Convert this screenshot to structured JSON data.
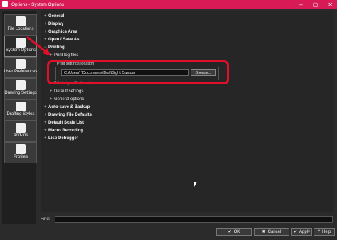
{
  "window": {
    "title": "Options - System Options",
    "controls": [
      "–",
      "▢",
      "✕"
    ]
  },
  "sidebar": {
    "items": [
      {
        "label": "File Locations",
        "icon": "folder-icon",
        "active": false
      },
      {
        "label": "System Options",
        "icon": "list-icon",
        "active": true
      },
      {
        "label": "User Preferences",
        "icon": "user-gear-icon",
        "active": false
      },
      {
        "label": "Drawing Settings",
        "icon": "drawing-icon",
        "active": false
      },
      {
        "label": "Drafting Styles",
        "icon": "style-icon",
        "active": false
      },
      {
        "label": "Add-Ins",
        "icon": "puzzle-icon",
        "active": false
      },
      {
        "label": "Profiles",
        "icon": "profiles-icon",
        "active": false
      }
    ]
  },
  "tree": {
    "general": "General",
    "display": "Display",
    "graphics_area": "Graphics Area",
    "open_save_as": "Open / Save As",
    "printing": "Printing",
    "print_log_files": "Print log files",
    "print_settings_location": "Print settings location",
    "path_value": "C:\\Users\\            \\Documents\\DraftSight Custom",
    "browse_label": "Browse...",
    "print_style_file_location": "Print style file location",
    "default_settings": "Default settings",
    "general_options": "General options",
    "auto_save_backup": "Auto-save & Backup",
    "drawing_file_defaults": "Drawing File Defaults",
    "default_scale_list": "Default Scale List",
    "macro_recording": "Macro Recording",
    "lisp_debugger": "Lisp Debugger"
  },
  "find": {
    "label": "Find:",
    "value": ""
  },
  "buttons": {
    "ok": "OK",
    "cancel": "Cancel",
    "apply": "Apply",
    "help": "Help"
  },
  "colors": {
    "titlebar": "#d81b57",
    "highlight": "#e0102a"
  }
}
